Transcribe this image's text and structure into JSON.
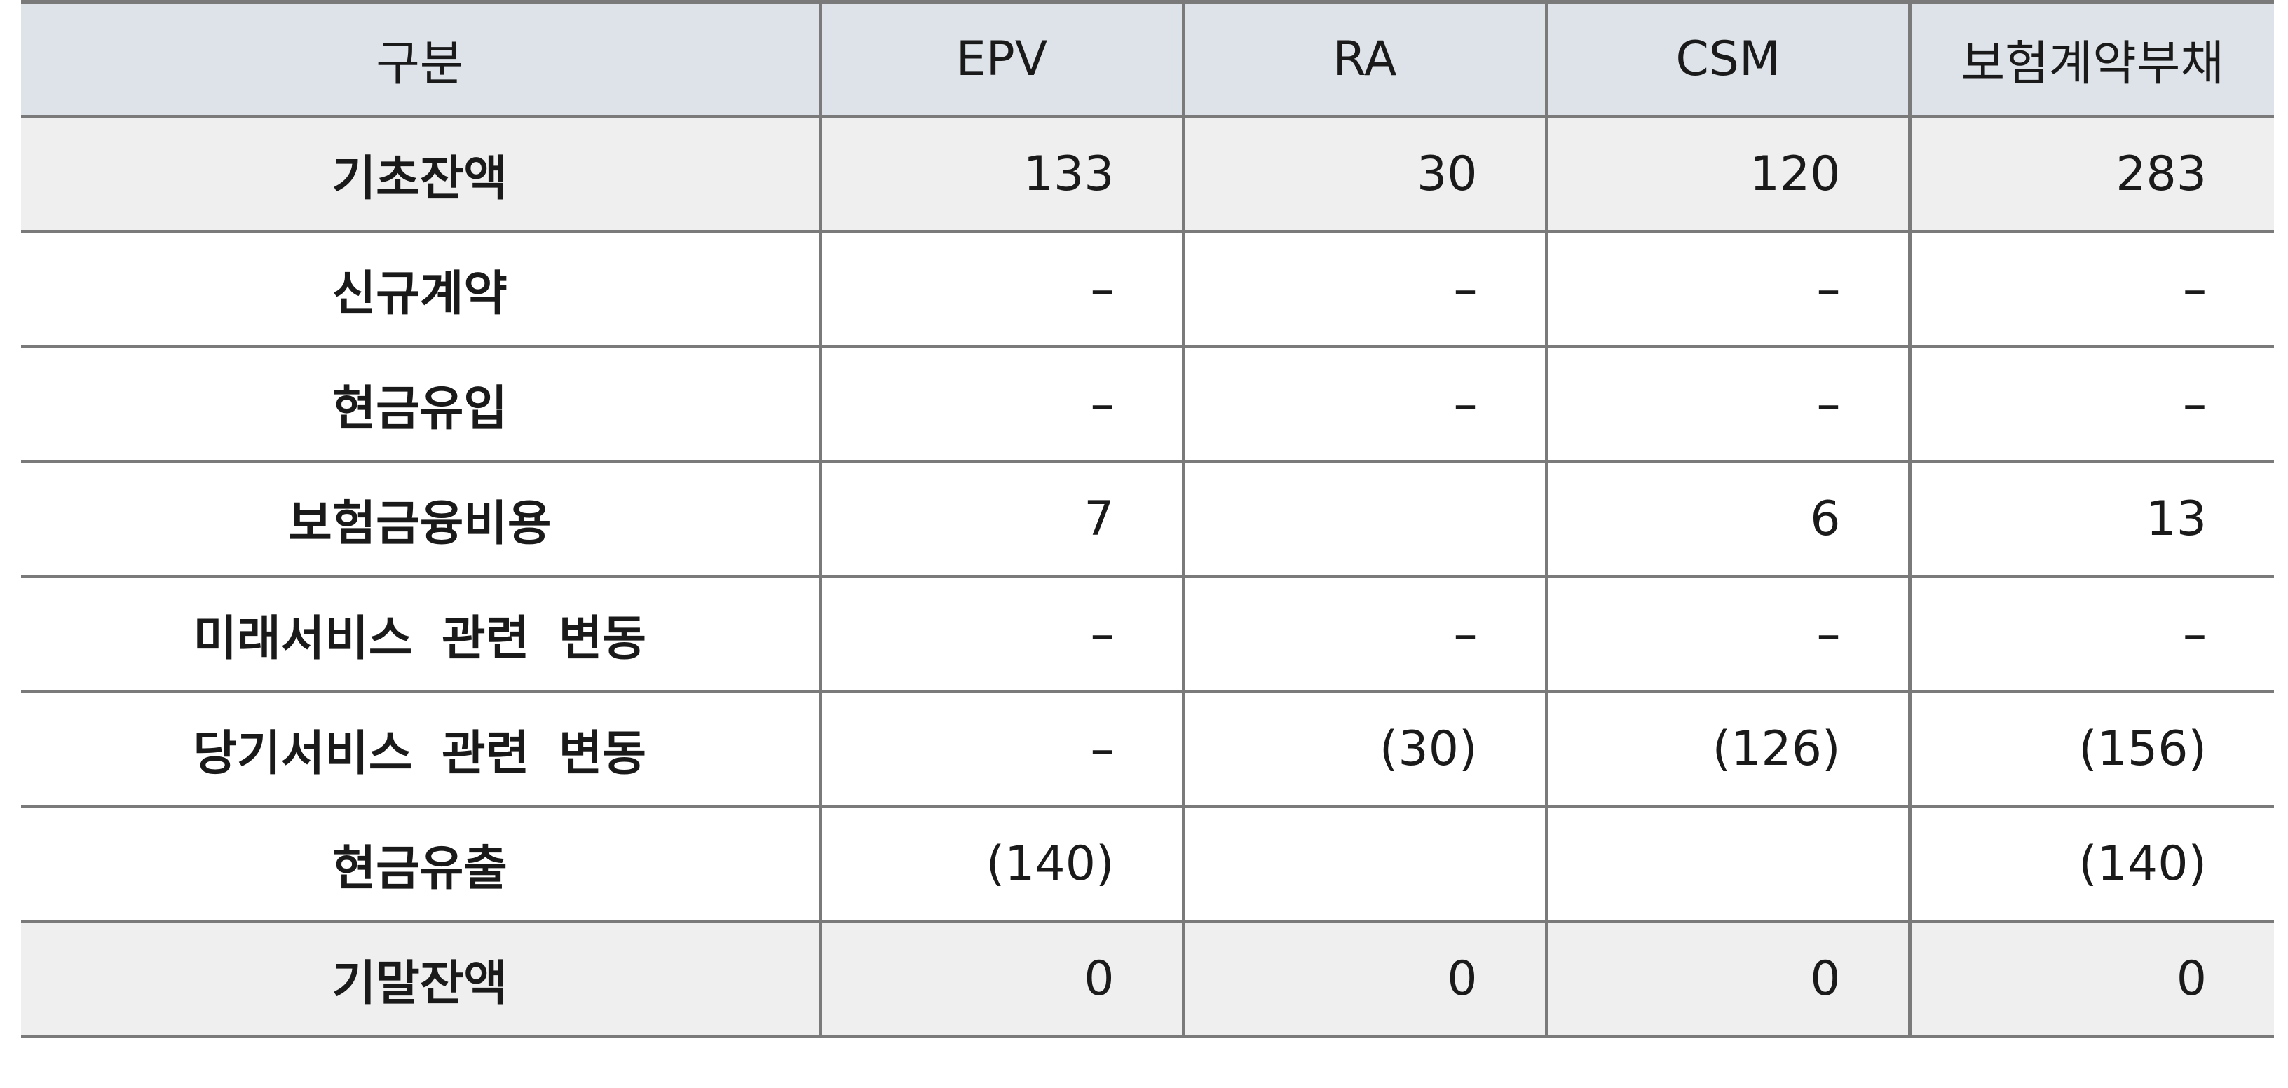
{
  "table": {
    "headers": [
      "구분",
      "EPV",
      "RA",
      "CSM",
      "보험계약부채"
    ],
    "rows": [
      {
        "label": "기초잔액",
        "values": [
          "133",
          "30",
          "120",
          "283"
        ],
        "shaded": true
      },
      {
        "label": "신규계약",
        "values": [
          "–",
          "–",
          "–",
          "–"
        ],
        "shaded": false
      },
      {
        "label": "현금유입",
        "values": [
          "–",
          "–",
          "–",
          "–"
        ],
        "shaded": false
      },
      {
        "label": "보험금융비용",
        "values": [
          "7",
          "",
          "6",
          "13"
        ],
        "shaded": false
      },
      {
        "label": "미래서비스 관련 변동",
        "values": [
          "–",
          "–",
          "–",
          "–"
        ],
        "shaded": false
      },
      {
        "label": "당기서비스 관련 변동",
        "values": [
          "–",
          "(30)",
          "(126)",
          "(156)"
        ],
        "shaded": false
      },
      {
        "label": "현금유출",
        "values": [
          "(140)",
          "",
          "",
          "(140)"
        ],
        "shaded": false
      },
      {
        "label": "기말잔액",
        "values": [
          "0",
          "0",
          "0",
          "0"
        ],
        "shaded": true
      }
    ]
  },
  "colors": {
    "header_bg": "#dde3e8",
    "shaded_row_bg": "#efefef",
    "border": "#7a7a7a"
  }
}
